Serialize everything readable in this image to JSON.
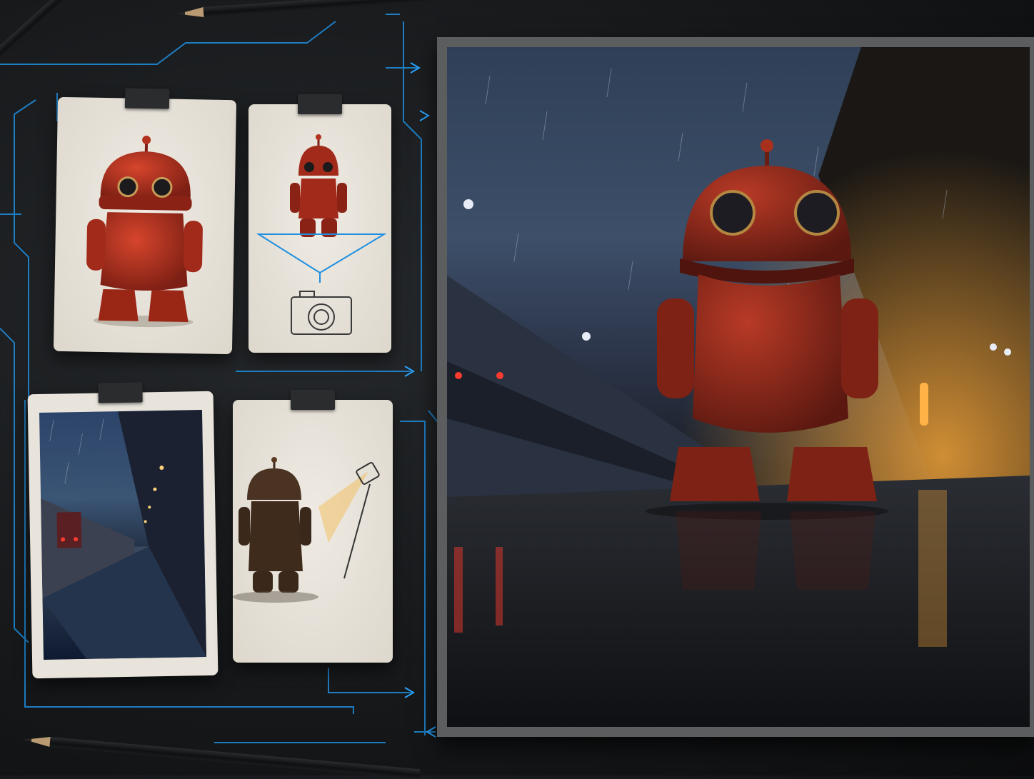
{
  "scene": {
    "description_colors": {
      "board": "#17191b",
      "circuit": "#1f8fe0",
      "robot": "#9a2b1e",
      "rain_sky": "#3d4f69",
      "warm_light": "#f0a33a"
    }
  },
  "cards": [
    {
      "icon": "robot-render-icon"
    },
    {
      "icon": "camera-icon"
    },
    {
      "icon": "train-station-photo-icon"
    },
    {
      "icon": "spotlight-icon"
    }
  ],
  "final_image": {
    "icon": "robot-in-rain-icon"
  }
}
